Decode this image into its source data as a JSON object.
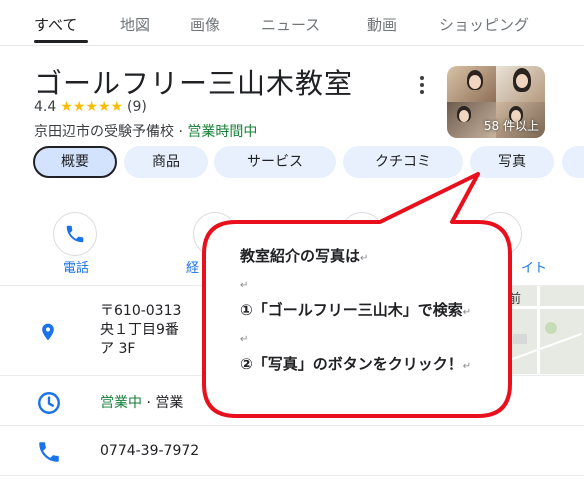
{
  "tabs": [
    "すべて",
    "地図",
    "画像",
    "ニュース",
    "動画",
    "ショッピング"
  ],
  "business": {
    "name": "ゴールフリー三山木教室",
    "rating": "4.4",
    "stars": "★★★★★",
    "review_count": "(9)",
    "category": "京田辺市の受験予備校",
    "separator": " · ",
    "status": "営業時間中",
    "photo_count": "58 件以上"
  },
  "chips": [
    "概要",
    "商品",
    "サービス",
    "クチコミ",
    "写真"
  ],
  "actions": {
    "call": "電話",
    "directions": "経",
    "website": "イト"
  },
  "info": {
    "address": "〒610-0313\n央１丁目9番\nア 3F",
    "hours_open": "営業中",
    "hours_rest": " · 営業",
    "phone": "0774-39-7972"
  },
  "map": {
    "label": "前"
  },
  "callout": {
    "line1": "教室紹介の写真は",
    "line2": "①「ゴールフリー三山木」で検索",
    "line3": "②「写真」のボタンをクリック！",
    "return_mark": "↵",
    "border_color": "#e8101c"
  }
}
